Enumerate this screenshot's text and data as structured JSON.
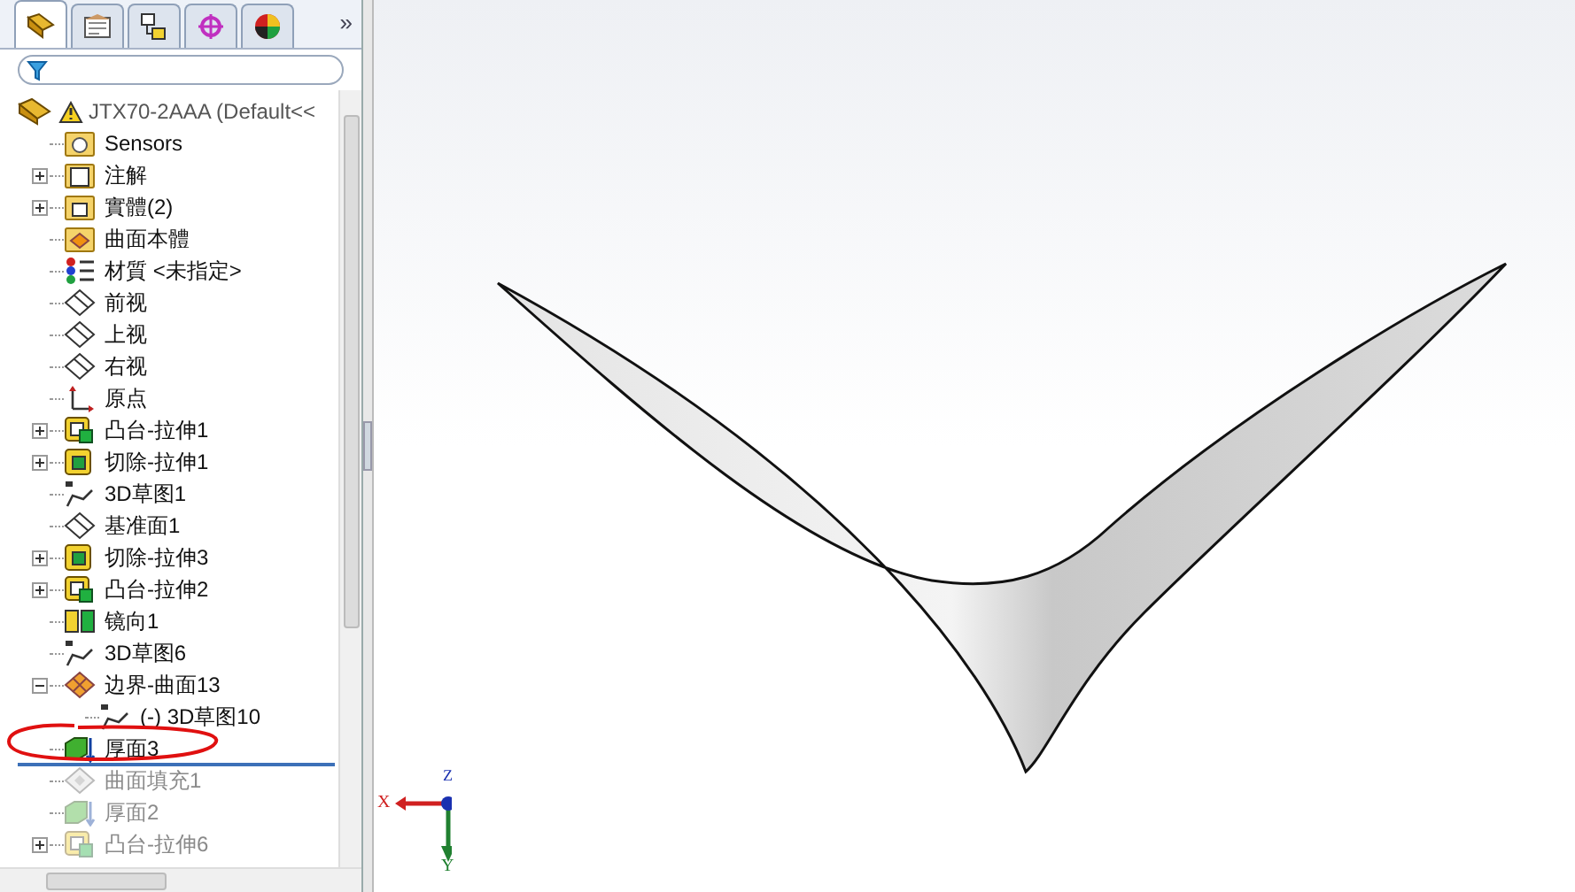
{
  "panel": {
    "tabs": [
      {
        "kind": "feature",
        "selected": true
      },
      {
        "kind": "property",
        "selected": false
      },
      {
        "kind": "config",
        "selected": false
      },
      {
        "kind": "dimxpert",
        "selected": false
      },
      {
        "kind": "display",
        "selected": false
      }
    ],
    "more": "»",
    "root": {
      "label": "JTX70-2AAA  (Default<<"
    },
    "items": [
      {
        "label": "Sensors",
        "kind": "sensors",
        "rolled_back": false
      },
      {
        "label": "注解",
        "kind": "annotation",
        "expanded": false,
        "rolled_back": false
      },
      {
        "label": "實體(2)",
        "kind": "solid",
        "expanded": false,
        "rolled_back": false
      },
      {
        "label": "曲面本體",
        "kind": "surfacebody",
        "rolled_back": false
      },
      {
        "label": "材質 <未指定>",
        "kind": "material",
        "rolled_back": false
      },
      {
        "label": "前视",
        "kind": "plane",
        "rolled_back": false
      },
      {
        "label": "上视",
        "kind": "plane",
        "rolled_back": false
      },
      {
        "label": "右视",
        "kind": "plane",
        "rolled_back": false
      },
      {
        "label": "原点",
        "kind": "origin",
        "rolled_back": false
      },
      {
        "label": "凸台-拉伸1",
        "kind": "boss",
        "expanded": false,
        "rolled_back": false
      },
      {
        "label": "切除-拉伸1",
        "kind": "cut",
        "expanded": false,
        "rolled_back": false
      },
      {
        "label": "3D草图1",
        "kind": "sketch3d",
        "rolled_back": false
      },
      {
        "label": "基准面1",
        "kind": "plane",
        "rolled_back": false
      },
      {
        "label": "切除-拉伸3",
        "kind": "cut",
        "expanded": false,
        "rolled_back": false
      },
      {
        "label": "凸台-拉伸2",
        "kind": "boss",
        "expanded": false,
        "rolled_back": false
      },
      {
        "label": "镜向1",
        "kind": "mirror",
        "rolled_back": false
      },
      {
        "label": "3D草图6",
        "kind": "sketch3d",
        "rolled_back": false
      },
      {
        "label": "边界-曲面13",
        "kind": "boundary",
        "expanded": true,
        "rolled_back": false,
        "children": [
          {
            "label": "(-) 3D草图10",
            "kind": "sketch3d",
            "rolled_back": false
          }
        ]
      },
      {
        "label": "厚面3",
        "kind": "thicken",
        "rolled_back": false
      },
      {
        "label": "曲面填充1",
        "kind": "fill",
        "rolled_back": true
      },
      {
        "label": "厚面2",
        "kind": "thicken",
        "rolled_back": true
      },
      {
        "label": "凸台-拉伸6",
        "kind": "boss",
        "expanded": false,
        "rolled_back": true
      }
    ]
  },
  "viewport": {
    "triad": {
      "x": "X",
      "y": "Y",
      "z": "Z"
    }
  }
}
